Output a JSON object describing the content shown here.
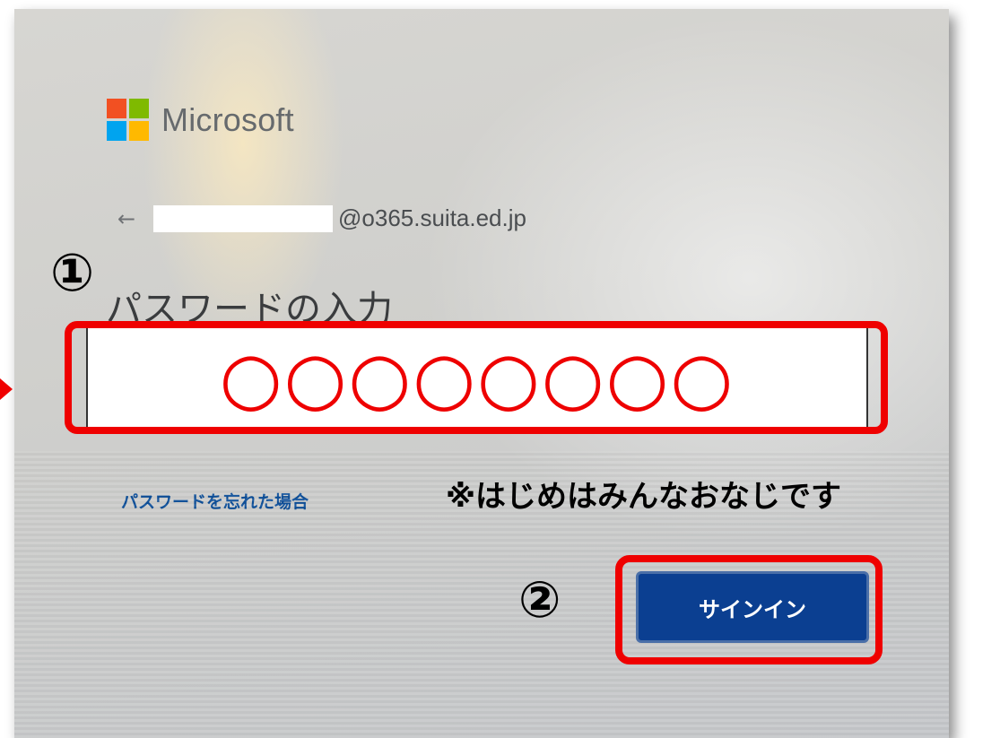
{
  "brand": {
    "name": "Microsoft",
    "logo_colors": [
      "#f25022",
      "#7fba00",
      "#00a4ef",
      "#ffb900"
    ]
  },
  "account": {
    "back_icon": "left-arrow-icon",
    "back_glyph": "←",
    "domain": "@o365.suita.ed.jp"
  },
  "page": {
    "title": "パスワードの入力"
  },
  "password_field": {
    "value": "○○○○○○○○"
  },
  "links": {
    "forgot_password": "パスワードを忘れた場合"
  },
  "annotations": {
    "step1": "①",
    "step2": "②",
    "note": "※はじめはみんなおなじです",
    "highlight_color": "#ef0000"
  },
  "buttons": {
    "signin_label": "サインイン",
    "signin_color": "#0b3f91"
  }
}
